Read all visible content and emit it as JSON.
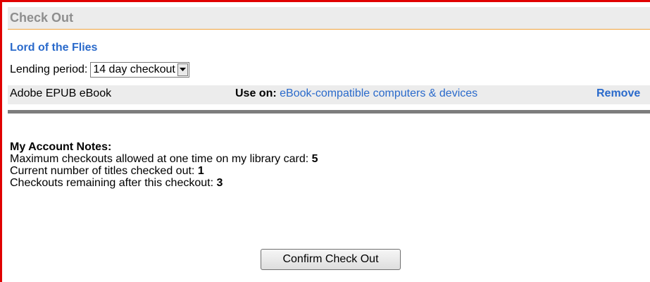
{
  "header": {
    "title": "Check Out"
  },
  "book": {
    "title": "Lord of the Flies"
  },
  "lending": {
    "label": "Lending period:",
    "selected": "14 day checkout"
  },
  "format": {
    "name": "Adobe EPUB eBook",
    "use_on_label": "Use on:",
    "use_on_link": "eBook-compatible computers & devices",
    "remove_label": "Remove"
  },
  "notes": {
    "heading": "My Account Notes:",
    "max_label": "Maximum checkouts allowed at one time on my library card:",
    "max_value": "5",
    "current_label": "Current number of titles checked out:",
    "current_value": "1",
    "remaining_label": "Checkouts remaining after this checkout:",
    "remaining_value": "3"
  },
  "actions": {
    "confirm_label": "Confirm Check Out"
  },
  "colors": {
    "accent_border": "#e00000",
    "link": "#2a6acb",
    "header_rule": "#f0a23c",
    "header_text": "#8e8e8e"
  },
  "icons": {
    "select_arrow": "chevron-down-icon"
  }
}
